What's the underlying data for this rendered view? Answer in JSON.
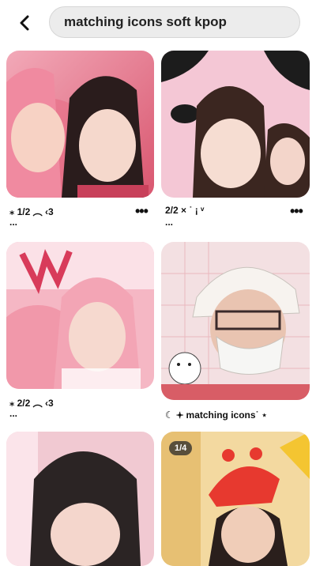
{
  "search": {
    "query": "matching icons soft kpop"
  },
  "pins": [
    {
      "caption": "⁎ 1/2 ︵ ‹3",
      "more": "•••",
      "extra": "..."
    },
    {
      "caption": "2/2 × ˙ ¡ ᵛ",
      "more": "•••",
      "extra": "..."
    },
    {
      "caption": "⁎ 2/2 ︵ ‹3",
      "more": "•••",
      "extra": "..."
    },
    {
      "caption": "☾ 𖥔 matching icons˙ ⋆",
      "more": "•••"
    },
    {
      "badge": "1/4"
    }
  ],
  "icons": [
    "back-arrow-icon",
    "more-options-icon"
  ]
}
